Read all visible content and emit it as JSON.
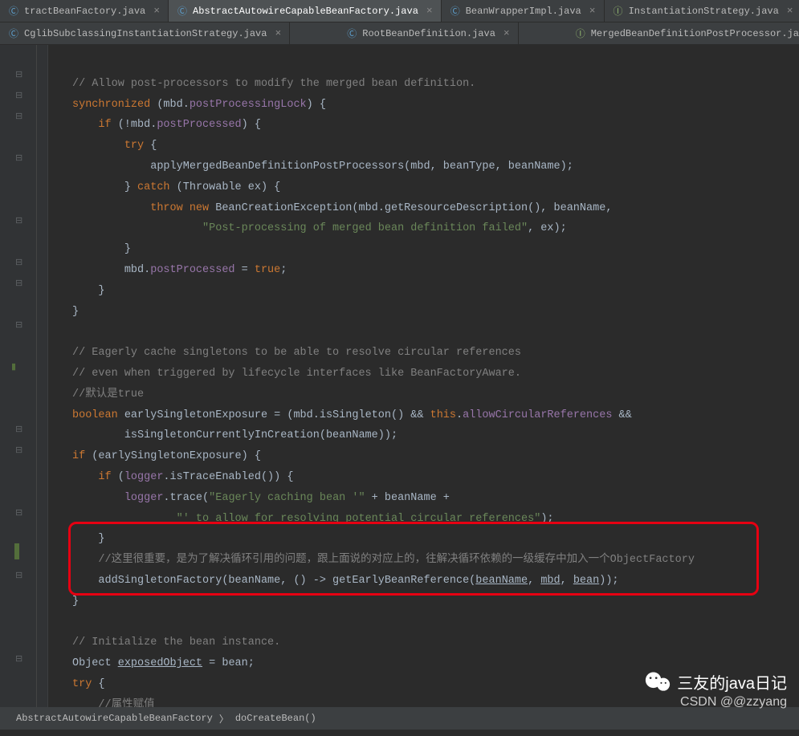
{
  "tabs_row1": [
    {
      "name": "tractBeanFactory.java",
      "icon": "c",
      "close": "×",
      "active": false
    },
    {
      "name": "AbstractAutowireCapableBeanFactory.java",
      "icon": "c",
      "close": "×",
      "active": true
    },
    {
      "name": "BeanWrapperImpl.java",
      "icon": "c",
      "close": "×",
      "active": false
    },
    {
      "name": "InstantiationStrategy.java",
      "icon": "i",
      "close": "×",
      "active": false
    }
  ],
  "tabs_row2": [
    {
      "name": "CglibSubclassingInstantiationStrategy.java",
      "icon": "c",
      "close": "×",
      "active": false
    },
    {
      "name": "RootBeanDefinition.java",
      "icon": "c",
      "close": "×",
      "active": false
    },
    {
      "name": "MergedBeanDefinitionPostProcessor.java",
      "icon": "i",
      "close": "",
      "active": false
    }
  ],
  "code": {
    "l1": "// Allow post-processors to modify the merged bean definition.",
    "l2a": "synchronized",
    "l2b": " (mbd.",
    "l2c": "postProcessingLock",
    "l2d": ") {",
    "l3a": "if",
    "l3b": " (!mbd.",
    "l3c": "postProcessed",
    "l3d": ") {",
    "l4a": "try",
    "l4b": " {",
    "l5": "applyMergedBeanDefinitionPostProcessors(mbd, beanType, beanName);",
    "l6a": "}",
    "l6b": " catch ",
    "l6c": "(Throwable ex) {",
    "l7a": "throw new ",
    "l7b": "BeanCreationException(mbd.getResourceDescription(), beanName,",
    "l8a": "\"Post-processing of merged bean definition failed\"",
    "l8b": ", ex);",
    "l9": "}",
    "l10a": "mbd.",
    "l10b": "postProcessed",
    "l10c": " = ",
    "l10d": "true",
    "l10e": ";",
    "l11": "}",
    "l12": "}",
    "l13": "",
    "l14": "// Eagerly cache singletons to be able to resolve circular references",
    "l15": "// even when triggered by lifecycle interfaces like BeanFactoryAware.",
    "l16": "//默认是true",
    "l17a": "boolean",
    "l17b": " earlySingletonExposure = (mbd.isSingleton() && ",
    "l17c": "this",
    "l17d": ".",
    "l17e": "allowCircularReferences",
    "l17f": " &&",
    "l18": "isSingletonCurrentlyInCreation(beanName));",
    "l19a": "if",
    "l19b": " (earlySingletonExposure) {",
    "l20a": "if",
    "l20b": " (",
    "l20c": "logger",
    "l20d": ".isTraceEnabled()) {",
    "l21a": "logger",
    "l21b": ".trace(",
    "l21c": "\"Eagerly caching bean '\"",
    "l21d": " + beanName +",
    "l22a": "\"' to allow for resolving potential circular references\"",
    "l22b": ");",
    "l23": "}",
    "l24": "//这里很重要，是为了解决循环引用的问题，跟上面说的对应上的，往解决循环依赖的一级缓存中加入一个ObjectFactory",
    "l25a": "addSingletonFactory(beanName, () -> getEarlyBeanReference(",
    "l25b": "beanName",
    "l25c": ", ",
    "l25d": "mbd",
    "l25e": ", ",
    "l25f": "bean",
    "l25g": "));",
    "l26": "}",
    "l27": "",
    "l28": "// Initialize the bean instance.",
    "l29a": "Object ",
    "l29b": "exposedObject",
    "l29c": " = bean;",
    "l30a": "try",
    "l30b": " {",
    "l31": "//属性赋值"
  },
  "statusbar": {
    "crumb1": "AbstractAutowireCapableBeanFactory",
    "sep": "〉",
    "crumb2": "doCreateBean()"
  },
  "watermark": {
    "wechat_text": "三友的java日记",
    "credit": "CSDN @@zzyang"
  },
  "icons": {
    "close": "×"
  }
}
